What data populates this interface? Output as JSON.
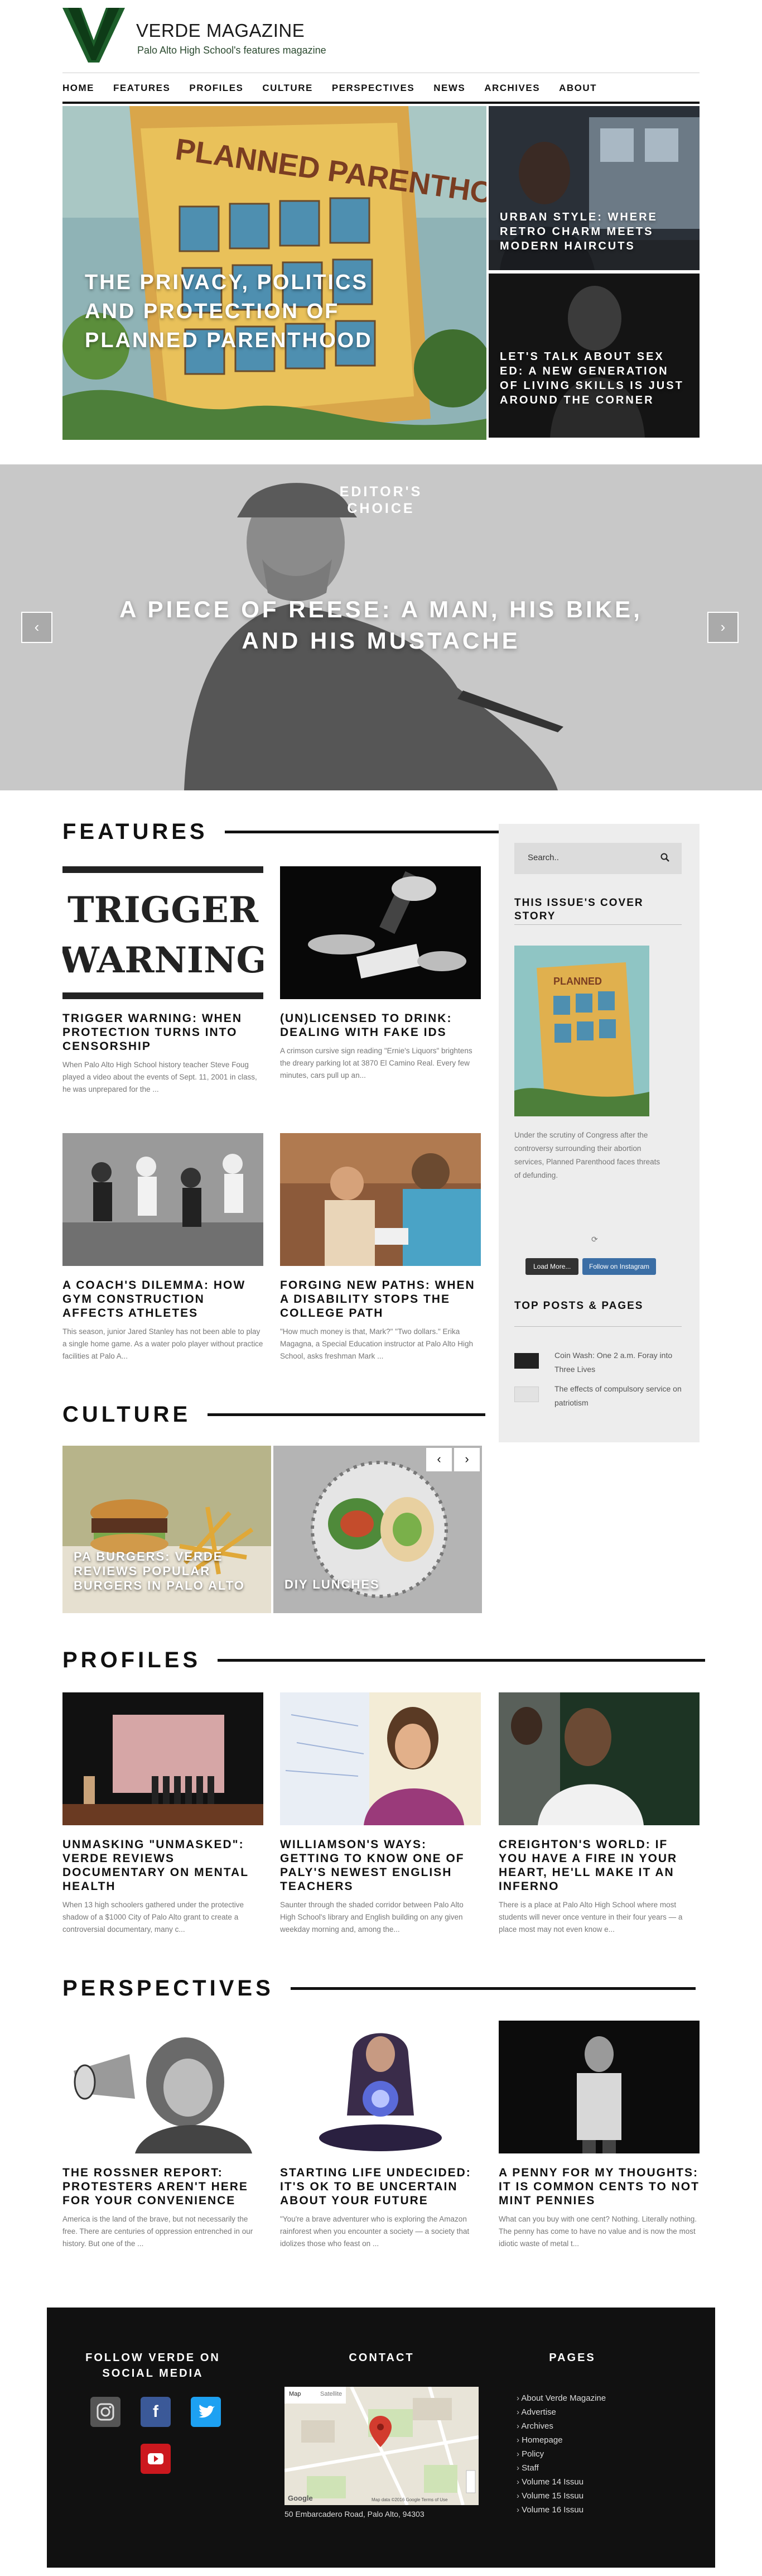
{
  "brand": {
    "title": "VERDE MAGAZINE",
    "subtitle": "Palo Alto High School's features magazine",
    "logo_letter": "V"
  },
  "nav": [
    "HOME",
    "FEATURES",
    "PROFILES",
    "CULTURE",
    "PERSPECTIVES",
    "NEWS",
    "ARCHIVES",
    "ABOUT"
  ],
  "hero": {
    "main_title": "THE PRIVACY, POLITICS AND PROTECTION OF PLANNED PARENTHOOD",
    "side": [
      "URBAN STYLE: WHERE RETRO CHARM MEETS MODERN HAIRCUTS",
      "LET'S TALK ABOUT SEX ED: A NEW GENERATION OF LIVING SKILLS IS JUST AROUND THE CORNER"
    ]
  },
  "editors_choice": {
    "label": "EDITOR'S CHOICE",
    "title": "A PIECE OF REESE: A MAN, HIS BIKE, AND HIS MUSTACHE",
    "prev": "‹",
    "next": "›"
  },
  "features": {
    "heading": "FEATURES",
    "cards": [
      {
        "title": "TRIGGER WARNING: WHEN PROTECTION TURNS INTO CENSORSHIP",
        "excerpt": "When Palo Alto High School history teacher Steve Foug played a video about the events of Sept. 11, 2001 in class, he was unprepared for the ...",
        "image_text": "TRIGGER WARNING"
      },
      {
        "title": "(UN)LICENSED TO DRINK: DEALING WITH FAKE IDS",
        "excerpt": "A crimson cursive sign reading \"Ernie's Liquors\" brightens the dreary parking lot at 3870 El Camino Real. Every few minutes, cars pull up an..."
      },
      {
        "title": "A COACH'S DILEMMA: HOW GYM CONSTRUCTION AFFECTS ATHLETES",
        "excerpt": "This season, junior Jared Stanley has not been able to play a single home game. As a water polo player without practice facilities at Palo A..."
      },
      {
        "title": "FORGING NEW PATHS: WHEN A DISABILITY STOPS THE COLLEGE PATH",
        "excerpt": "\"How much money is that, Mark?\" \"Two dollars.\" Erika Magagna, a Special Education instructor at Palo Alto High School, asks freshman Mark ..."
      }
    ]
  },
  "sidebar": {
    "search_placeholder": "Search..",
    "cover_heading": "THIS ISSUE'S COVER STORY",
    "cover_text": "Under the scrutiny of Congress after the controversy surrounding their abortion services, Planned Parenthood faces threats of defunding.",
    "cover_sign": "PLANNED PARENTHOOD",
    "load_more": "Load More...",
    "follow_ig": "Follow on Instagram",
    "top_heading": "TOP POSTS & PAGES",
    "top_items": [
      "Coin Wash: One 2 a.m. Foray into Three Lives",
      "The effects of compulsory service on patriotism"
    ]
  },
  "culture": {
    "heading": "CULTURE",
    "slides": [
      "PA BURGERS: VERDE REVIEWS POPULAR BURGERS IN PALO ALTO",
      "DIY LUNCHES"
    ],
    "prev": "‹",
    "next": "›"
  },
  "profiles": {
    "heading": "PROFILES",
    "cards": [
      {
        "title": "UNMASKING \"UNMASKED\": VERDE REVIEWS DOCUMENTARY ON MENTAL HEALTH",
        "excerpt": "When 13 high schoolers gathered under the protective shadow of a $1000 City of Palo Alto grant to create a controversial documentary, many c..."
      },
      {
        "title": "WILLIAMSON'S WAYS: GETTING TO KNOW ONE OF PALY'S NEWEST ENGLISH TEACHERS",
        "excerpt": "Saunter through the shaded corridor between Palo Alto High School's library and English building on any given weekday morning and, among the..."
      },
      {
        "title": "CREIGHTON'S WORLD: IF YOU HAVE A FIRE IN YOUR HEART, HE'LL MAKE IT AN INFERNO",
        "excerpt": "There is a place at Palo Alto High School where most students will never once venture in their four years — a place most may not even know e..."
      }
    ]
  },
  "perspectives": {
    "heading": "PERSPECTIVES",
    "cards": [
      {
        "title": "THE ROSSNER REPORT: PROTESTERS AREN'T HERE FOR YOUR CONVENIENCE",
        "excerpt": "America is the land of the brave, but not necessarily the free. There are centuries of oppression entrenched in our history. But one of the ..."
      },
      {
        "title": "STARTING LIFE UNDECIDED: IT'S OK TO BE UNCERTAIN ABOUT YOUR FUTURE",
        "excerpt": "\"You're a brave adventurer who is exploring the Amazon rainforest when you encounter a society — a society that idolizes those who feast on ..."
      },
      {
        "title": "A PENNY FOR MY THOUGHTS: IT IS COMMON CENTS TO NOT MINT PENNIES",
        "excerpt": "What can you buy with one cent? Nothing. Literally nothing. The penny has come to have no value and is now the most idiotic waste of metal t..."
      }
    ]
  },
  "footer": {
    "follow_heading": "FOLLOW VERDE ON SOCIAL MEDIA",
    "contact_heading": "CONTACT",
    "pages_heading": "PAGES",
    "address": "50 Embarcadero Road, Palo Alto, 94303",
    "map_tabs": [
      "Map",
      "Satellite"
    ],
    "map_google": "Google",
    "map_footer": "Map data ©2016 Google   Terms of Use",
    "pages": [
      "About Verde Magazine",
      "Advertise",
      "Archives",
      "Homepage",
      "Policy",
      "Staff",
      "Volume 14 Issuu",
      "Volume 15 Issuu",
      "Volume 16 Issuu"
    ]
  },
  "colors": {
    "brand_green": "#1d5e2a",
    "dark": "#111111",
    "sidebar": "#ededed",
    "footer": "#111111",
    "facebook": "#3b5998",
    "twitter": "#1da1f2",
    "youtube": "#cc181e",
    "instagram": "#555555"
  }
}
